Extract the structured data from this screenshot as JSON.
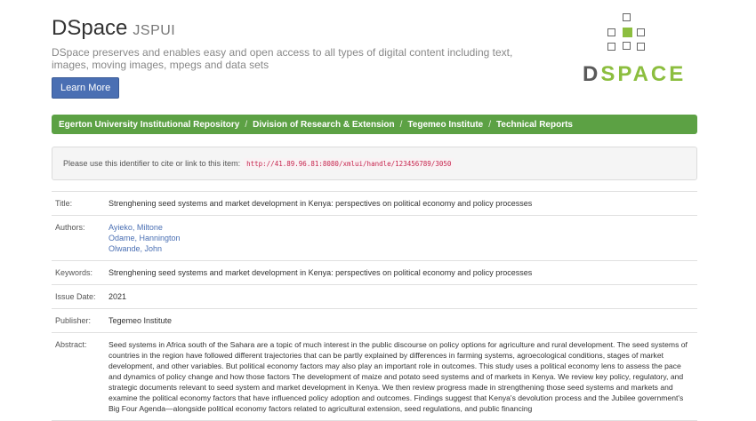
{
  "header": {
    "title": "DSpace",
    "subtitle": "JSPUI",
    "tagline": "DSpace preserves and enables easy and open access to all types of digital content including text, images, moving images, mpegs and data sets",
    "learn_more": "Learn More"
  },
  "logo": {
    "d": "D",
    "rest": "SPACE"
  },
  "breadcrumb": [
    "Egerton University Institutional Repository",
    "Division of Research & Extension",
    "Tegemeo Institute",
    "Technical Reports"
  ],
  "cite": {
    "label": "Please use this identifier to cite or link to this item:",
    "url": "http://41.89.96.81:8080/xmlui/handle/123456789/3050"
  },
  "metadata": {
    "title_label": "Title:",
    "title_value": "Strenghening seed systems and market development in Kenya: perspectives on political economy and policy processes",
    "authors_label": "Authors:",
    "authors": [
      "Ayieko, Miltone",
      "Odame, Hannington",
      "Olwande, John"
    ],
    "keywords_label": "Keywords:",
    "keywords_value": "Strenghening seed systems and market development in Kenya: perspectives on political economy and policy processes",
    "issue_label": "Issue Date:",
    "issue_value": "2021",
    "publisher_label": "Publisher:",
    "publisher_value": "Tegemeo Institute",
    "abstract_label": "Abstract:",
    "abstract_value": "Seed systems in Africa south of the Sahara are a topic of much interest in the public discourse on policy options for agriculture and rural development. The seed systems of countries in the region have followed different trajectories that can be partly explained by differences in farming systems, agroecological conditions, stages of market development, and other variables. But political economy factors may also play an important role in outcomes. This study uses a political economy lens to assess the pace and dynamics of policy change and how those factors The development of maize and potato seed systems and of markets in Kenya. We review key policy, regulatory, and strategic documents relevant to seed system and market development in Kenya. We then review progress made in strengthening those seed systems and markets and examine the political economy factors that have influenced policy adoption and outcomes. Findings suggest that Kenya's devolution process and the Jubilee government's Big Four Agenda—alongside political economy factors related to agricultural extension, seed regulations, and public financing"
  }
}
